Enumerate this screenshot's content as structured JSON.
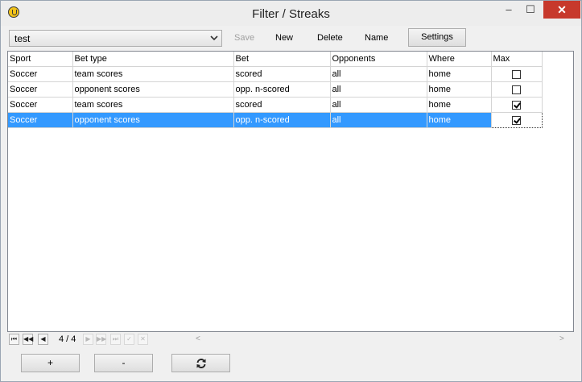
{
  "window": {
    "title": "Filter / Streaks",
    "minimize": "‒",
    "maximize": "☐",
    "close": "✕"
  },
  "toolbar": {
    "combo_value": "test",
    "save_label": "Save",
    "new_label": "New",
    "delete_label": "Delete",
    "name_label": "Name",
    "settings_label": "Settings"
  },
  "grid": {
    "columns": [
      "Sport",
      "Bet type",
      "Bet",
      "Opponents",
      "Where",
      "Max"
    ],
    "rows": [
      {
        "sport": "Soccer",
        "bet_type": "team scores",
        "bet": "scored",
        "opponents": "all",
        "where": "home",
        "max": false
      },
      {
        "sport": "Soccer",
        "bet_type": "opponent scores",
        "bet": "opp. n-scored",
        "opponents": "all",
        "where": "home",
        "max": false
      },
      {
        "sport": "Soccer",
        "bet_type": "team scores",
        "bet": "scored",
        "opponents": "all",
        "where": "home",
        "max": true
      },
      {
        "sport": "Soccer",
        "bet_type": "opponent scores",
        "bet": "opp. n-scored",
        "opponents": "all",
        "where": "home",
        "max": true
      }
    ],
    "selected_row": 3
  },
  "navigator": {
    "position": "4 / 4"
  },
  "bottom": {
    "plus_label": "+",
    "minus_label": "-",
    "refresh_icon": "refresh-icon"
  }
}
